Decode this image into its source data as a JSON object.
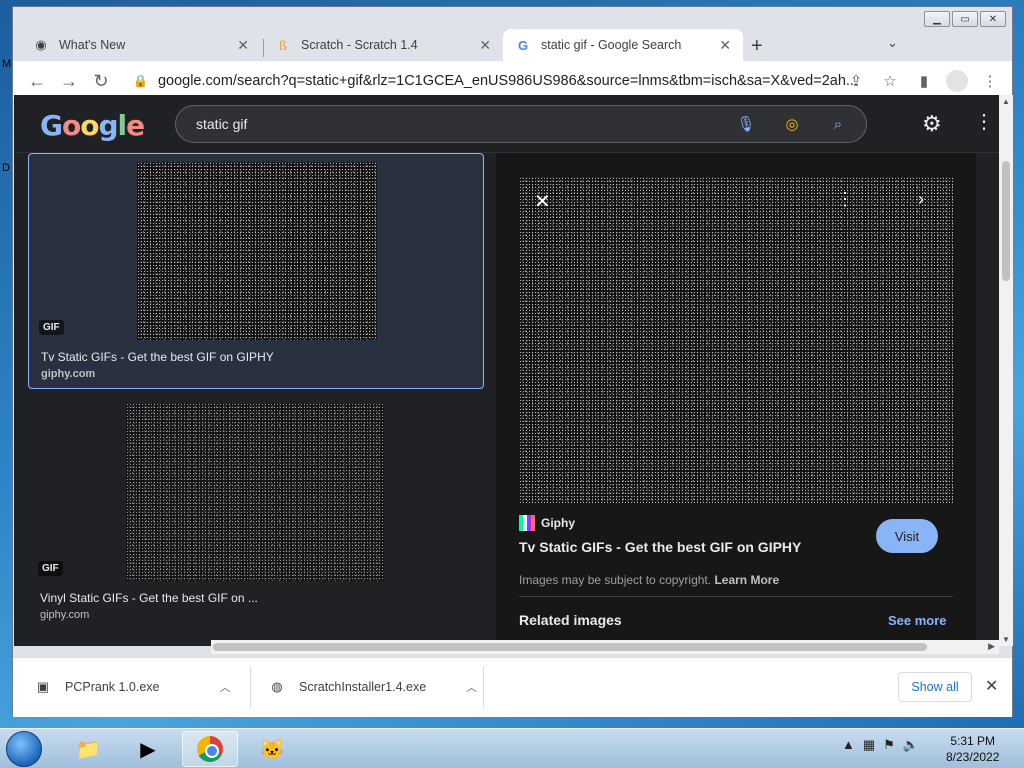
{
  "browser": {
    "tabs": [
      {
        "title": "What's New",
        "icon": "chrome-icon"
      },
      {
        "title": "Scratch - Scratch 1.4",
        "icon": "scratch-icon"
      },
      {
        "title": "static gif - Google Search",
        "icon": "google-icon"
      }
    ],
    "url": "google.com/search?q=static+gif&rlz=1C1GCEA_enUS986US986&source=lnms&tbm=isch&sa=X&ved=2ah..."
  },
  "google": {
    "logo_text": "Google",
    "search_query": "static gif"
  },
  "results": [
    {
      "badge": "GIF",
      "title": "Tv Static GIFs - Get the best GIF on GIPHY",
      "source": "giphy.com"
    },
    {
      "badge": "GIF",
      "title": "Vinyl Static GIFs - Get the best GIF on ...",
      "source": "giphy.com"
    }
  ],
  "preview": {
    "site": "Giphy",
    "title": "Tv Static GIFs - Get the best GIF on GIPHY",
    "visit_label": "Visit",
    "copyright_text": "Images may be subject to copyright.",
    "learn_more": "Learn More",
    "related_label": "Related images",
    "see_more": "See more"
  },
  "downloads": [
    {
      "name": "PCPrank 1.0.exe",
      "icon": "exe-file-icon"
    },
    {
      "name": "ScratchInstaller1.4.exe",
      "icon": "installer-icon"
    }
  ],
  "downloads_show_all": "Show all",
  "taskbar": {
    "time": "5:31 PM",
    "date": "8/23/2022"
  },
  "colors": {
    "accent": "#8ab4f8",
    "page_bg": "#202124",
    "selected_card": "#293040"
  }
}
